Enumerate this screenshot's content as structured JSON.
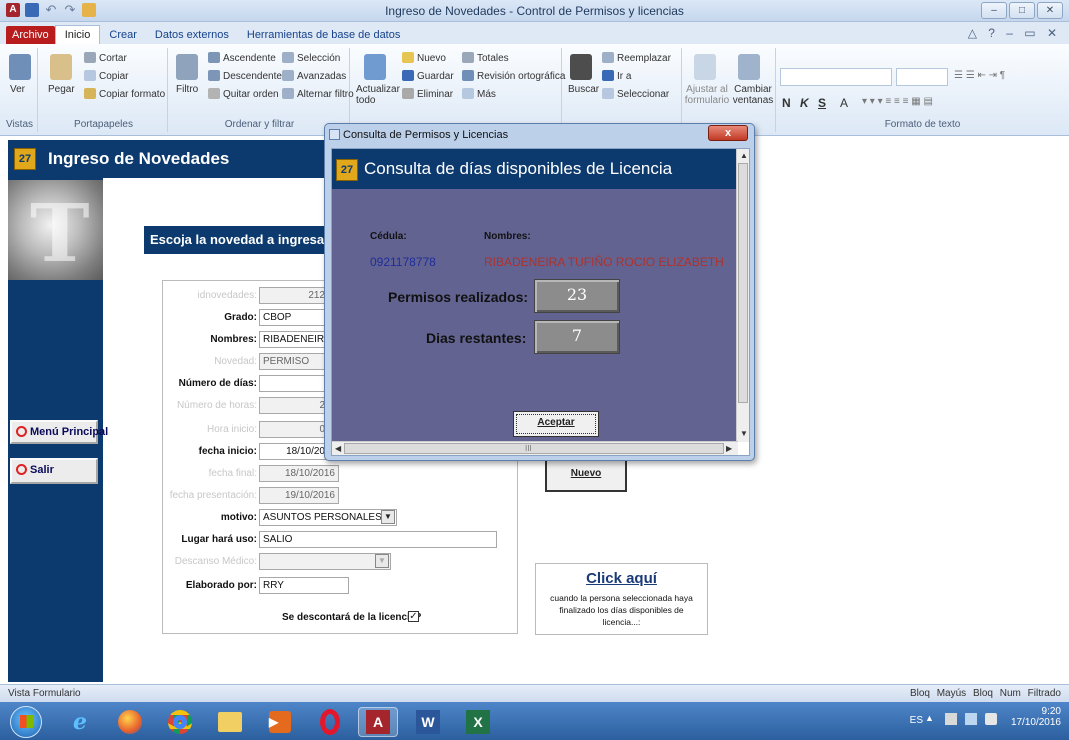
{
  "window": {
    "title": "Ingreso de Novedades - Control de Permisos y licencias",
    "controls": [
      "–",
      "□",
      "✕"
    ]
  },
  "ribbon": {
    "tabs": [
      "Archivo",
      "Inicio",
      "Crear",
      "Datos externos",
      "Herramientas de base de datos"
    ],
    "active_tab": "Inicio",
    "groups": {
      "vistas": {
        "label": "Vistas",
        "ver": "Ver"
      },
      "portapapeles": {
        "label": "Portapapeles",
        "pegar": "Pegar",
        "cortar": "Cortar",
        "copiar": "Copiar",
        "copiar_formato": "Copiar formato"
      },
      "ordenar": {
        "label": "Ordenar y filtrar",
        "filtro": "Filtro",
        "ascendente": "Ascendente",
        "descendente": "Descendente",
        "quitar_orden": "Quitar orden",
        "seleccion": "Selección",
        "avanzadas": "Avanzadas",
        "alternar_filtro": "Alternar filtro"
      },
      "registros": {
        "actualizar": "Actualizar todo",
        "nuevo": "Nuevo",
        "guardar": "Guardar",
        "eliminar": "Eliminar",
        "totales": "Totales",
        "revision": "Revisión ortográfica",
        "mas": "Más"
      },
      "buscar": {
        "buscar": "Buscar",
        "reemplazar": "Reemplazar",
        "ir_a": "Ir a",
        "seleccionar": "Seleccionar"
      },
      "ventana": {
        "ajustar": "Ajustar al formulario",
        "cambiar": "Cambiar ventanas"
      },
      "formato": {
        "label": "Formato de texto",
        "bold": "N",
        "italic": "K",
        "underline": "S",
        "font_color": "A"
      }
    }
  },
  "form": {
    "header": "Ingreso de Novedades",
    "prompt": "Escoja la novedad a ingresar:",
    "nav": {
      "menu_principal": "Menú Principal",
      "salir": "Salir"
    },
    "fields": {
      "idnovedades": {
        "label": "idnovedades:",
        "value": "212"
      },
      "grado": {
        "label": "Grado:",
        "value": "CBOP"
      },
      "nombres": {
        "label": "Nombres:",
        "value": "RIBADENEIRA TUFIÑO"
      },
      "novedad": {
        "label": "Novedad:",
        "value": "PERMISO"
      },
      "numero_dias": {
        "label": "Número de días:",
        "value": ""
      },
      "numero_horas": {
        "label": "Número de horas:",
        "value": "2"
      },
      "hora_inicio": {
        "label": "Hora inicio:",
        "value": "0"
      },
      "fecha_inicio": {
        "label": "fecha inicio:",
        "value": "18/10/20"
      },
      "fecha_final": {
        "label": "fecha final:",
        "value": "18/10/2016"
      },
      "fecha_presentacion": {
        "label": "fecha presentación:",
        "value": "19/10/2016"
      },
      "motivo": {
        "label": "motivo:",
        "value": "ASUNTOS PERSONALES"
      },
      "lugar_uso": {
        "label": "Lugar hará uso:",
        "value": "SALIO"
      },
      "descanso_medico": {
        "label": "Descanso Médico:",
        "value": ""
      },
      "elaborado_por": {
        "label": "Elaborado por:",
        "value": "RRY"
      },
      "descontara": {
        "label": "Se descontará de la licencia?",
        "checked": true
      }
    },
    "nuevo_button": "Nuevo",
    "click_aqui": {
      "title": "Click aquí",
      "description": "cuando la persona seleccionada haya finalizado los días disponibles de licencia...:"
    }
  },
  "dialog": {
    "window_title": "Consulta de Permisos y Licencias",
    "close": "x",
    "header": "Consulta de días disponibles de Licencia",
    "cedula_label": "Cédula:",
    "nombres_label": "Nombres:",
    "cedula_value": "0921178778",
    "nombres_value": "RIBADENEIRA TUFIÑO ROCIO ELIZABETH",
    "permisos_label": "Permisos realizados:",
    "permisos_value": "23",
    "dias_label": "Dias restantes:",
    "dias_value": "7",
    "aceptar": "Aceptar",
    "scroll_mark": "III"
  },
  "statusbar": {
    "left": "Vista Formulario",
    "right": "Bloq Mayús  Bloq Num  Filtrado"
  },
  "taskbar": {
    "lang": "ES",
    "time": "9:20",
    "date": "17/10/2016"
  },
  "colors": {
    "navy": "#0c3a6e",
    "dialog_panel": "#626391",
    "cedula_blue": "#1f2d9c",
    "name_red": "#b0312a"
  }
}
